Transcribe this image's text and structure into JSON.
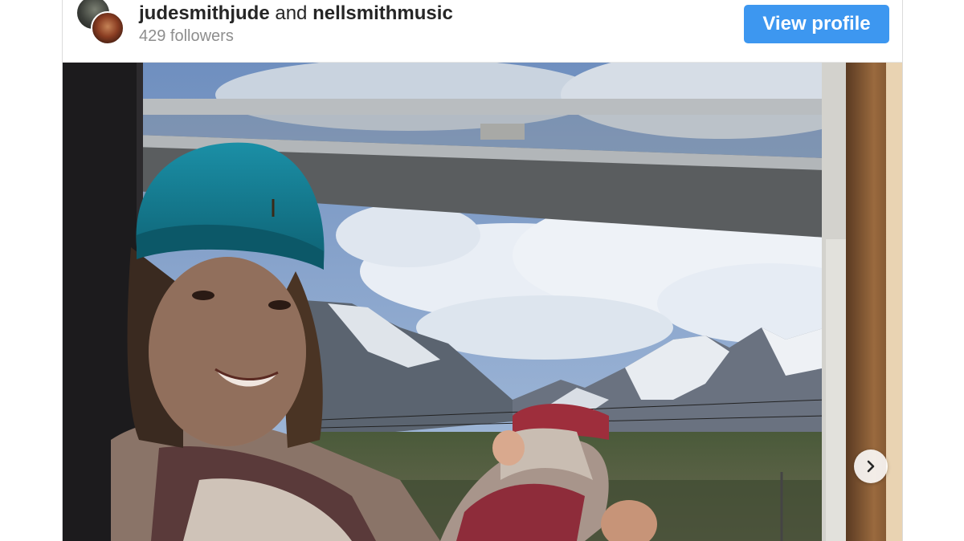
{
  "post": {
    "user1": "judesmithjude",
    "joiner": "and",
    "user2": "nellsmithmusic",
    "followers": "429 followers",
    "view_profile_label": "View profile"
  },
  "icons": {
    "avatar1": "avatar-icon",
    "avatar2": "avatar-icon",
    "next": "chevron-right-icon"
  },
  "colors": {
    "button_bg": "#3d97f0",
    "username_text": "#262626",
    "muted_text": "#8e8e8e"
  }
}
